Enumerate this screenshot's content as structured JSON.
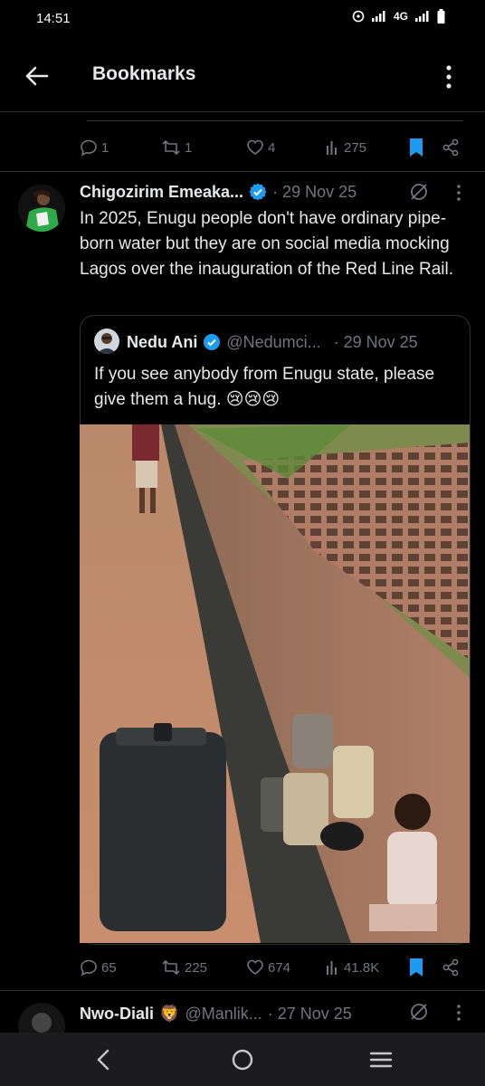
{
  "status": {
    "time": "14:51",
    "network": "4G"
  },
  "header": {
    "title": "Bookmarks"
  },
  "prev_tweet": {
    "stats": {
      "replies": "1",
      "reposts": "1",
      "likes": "4",
      "views": "275"
    }
  },
  "tweet": {
    "author": "Chigozirim Emeaka...",
    "date": "· 29 Nov 25",
    "text": "In 2025, Enugu people don't have ordinary pipe-born water but they are on social media mocking Lagos over the inauguration of the Red Line Rail.",
    "quote": {
      "author": "Nedu Ani",
      "handle": "@Nedumci...",
      "date": "· 29 Nov 25",
      "text": "If you see anybody from Enugu state, please give them a hug. 😢😢😢"
    },
    "stats": {
      "replies": "65",
      "reposts": "225",
      "likes": "674",
      "views": "41.8K"
    }
  },
  "next_tweet": {
    "author": "Nwo-Diali",
    "badge_emoji": "🦁",
    "handle": "@Manlik...",
    "date": "· 27 Nov 25"
  },
  "colors": {
    "accent": "#1d9bf0",
    "background": "#000000",
    "muted": "#71767b",
    "divider": "#2f3336"
  }
}
